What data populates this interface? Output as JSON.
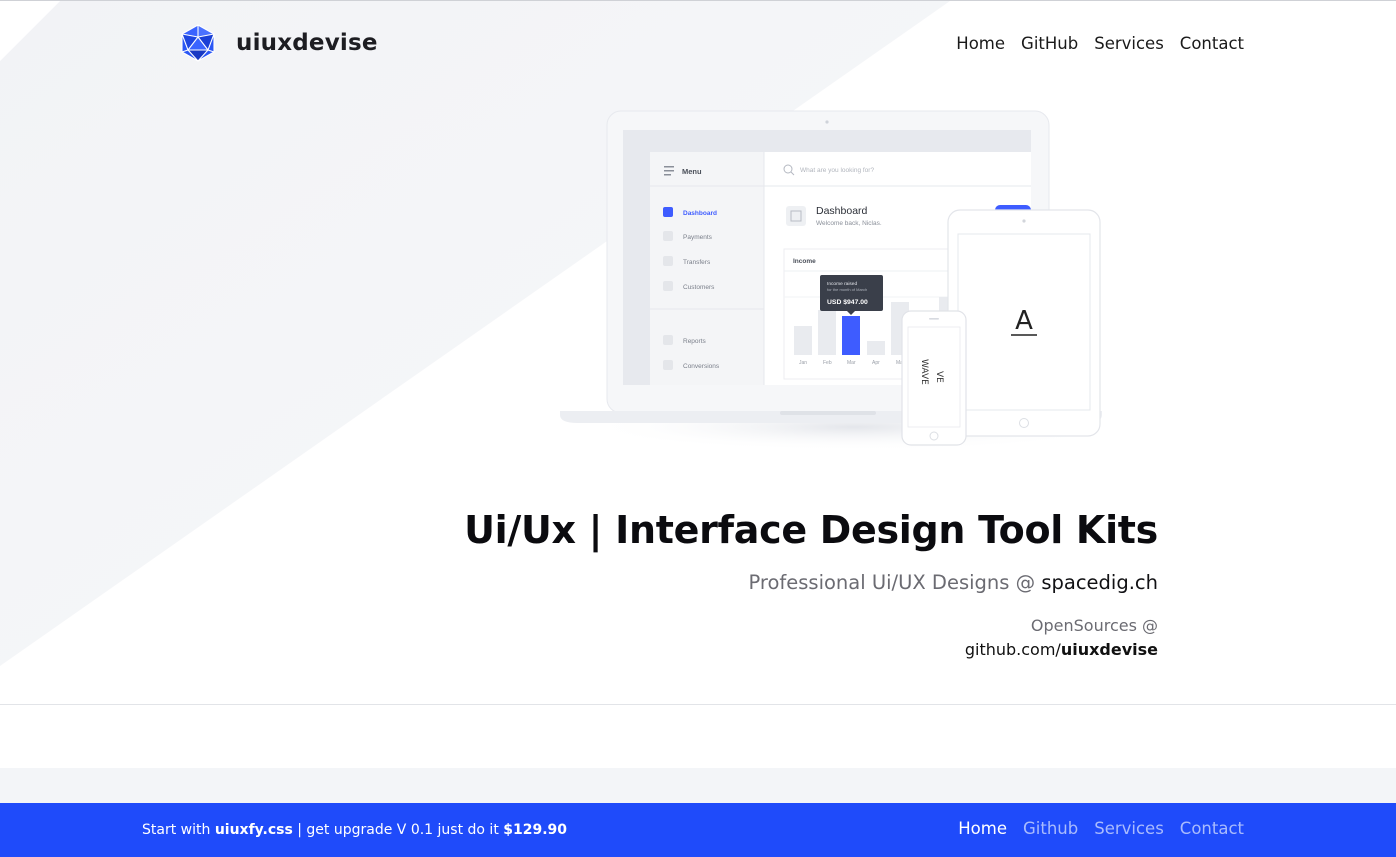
{
  "brand": {
    "name": "uiuxdevise"
  },
  "top_nav": [
    "Home",
    "GitHub",
    "Services",
    "Contact"
  ],
  "mockup": {
    "menu_label": "Menu",
    "search_placeholder": "What are you looking for?",
    "sidebar_items": [
      "Dashboard",
      "Payments",
      "Transfers",
      "Customers",
      "Reports",
      "Conversions"
    ],
    "dashboard_title": "Dashboard",
    "dashboard_subtitle": "Welcome back, Niclas.",
    "income_label": "Income",
    "tooltip_line1": "Income raised",
    "tooltip_line2": "for the month of March",
    "tooltip_value": "USD $947.00",
    "chart_months": [
      "Jan",
      "Feb",
      "Mar",
      "Apr",
      "Ma"
    ],
    "tablet_glyph": "A",
    "phone_glyph_1": "WAVE",
    "phone_glyph_2": "VE",
    "accent_color": "#3e5cff"
  },
  "hero": {
    "headline": "Ui/Ux | Interface Design Tool Kits",
    "subline_muted": "Professional Ui/UX Designs @ ",
    "subline_dark": "spacedig.ch",
    "os_line1": "OpenSources @",
    "os_line2_prefix": "github.com/",
    "os_line2_bold": "uiuxdevise"
  },
  "footer": {
    "promo_start": "Start with ",
    "promo_product": "uiuxfy.css",
    "promo_mid": " | get upgrade V 0.1 just do it ",
    "promo_price": "$129.90",
    "nav": [
      "Home",
      "Github",
      "Services",
      "Contact"
    ],
    "bg_color": "#1f4bfa"
  }
}
